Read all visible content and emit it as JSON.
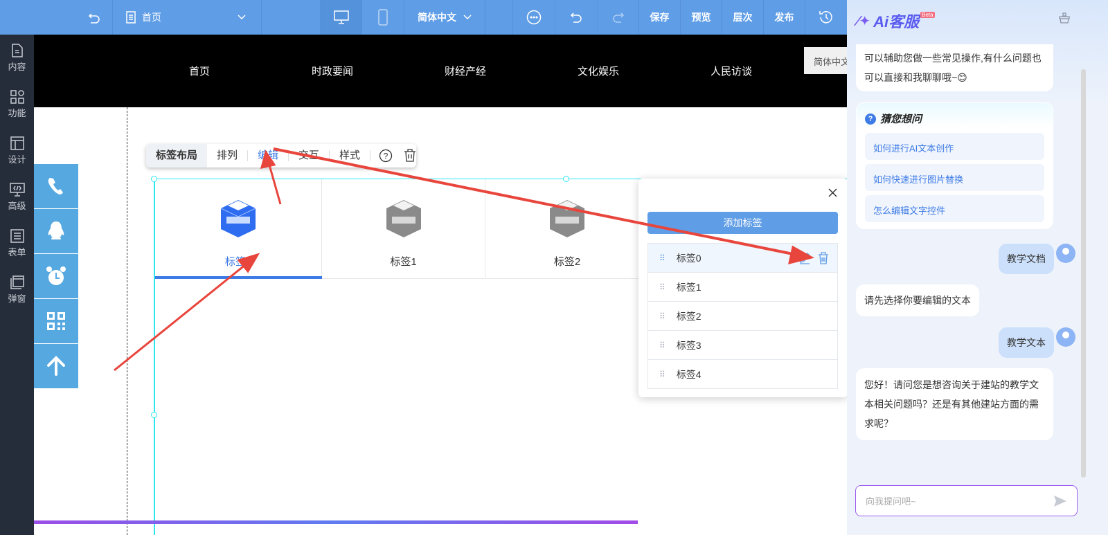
{
  "topbar": {
    "page_name": "首页",
    "language": "简体中文",
    "save": "保存",
    "preview": "预览",
    "layers": "层次",
    "publish": "发布"
  },
  "sidebar": [
    {
      "label": "内容",
      "icon": "file-icon"
    },
    {
      "label": "功能",
      "icon": "apps-icon"
    },
    {
      "label": "设计",
      "icon": "layout-icon"
    },
    {
      "label": "高级",
      "icon": "code-icon"
    },
    {
      "label": "表单",
      "icon": "form-icon"
    },
    {
      "label": "弹窗",
      "icon": "popup-icon"
    }
  ],
  "site_nav": {
    "items": [
      "首页",
      "时政要闻",
      "财经产经",
      "文化娱乐",
      "人民访谈"
    ],
    "language": "简体中文"
  },
  "float_buttons": [
    "phone-icon",
    "qq-icon",
    "alarm-icon",
    "qrcode-icon",
    "arrow-up-icon"
  ],
  "toolbar": {
    "title": "标签布局",
    "items": [
      "排列",
      "编辑",
      "交互",
      "样式"
    ]
  },
  "tabs": [
    {
      "label": "标签0",
      "active": true
    },
    {
      "label": "标签1"
    },
    {
      "label": "标签2"
    }
  ],
  "popup": {
    "add_label": "添加标签",
    "items": [
      "标签0",
      "标签1",
      "标签2",
      "标签3",
      "标签4"
    ]
  },
  "chat": {
    "title": "Ai客服",
    "badge": "Beta",
    "intro": "可以辅助您做一些常见操作,有什么问题也可以直接和我聊聊哦~😊",
    "suggest_title": "猜您想问",
    "suggestions": [
      "如何进行AI文本创作",
      "如何快速进行图片替换",
      "怎么编辑文字控件"
    ],
    "messages": [
      {
        "from": "user",
        "text": "教学文档"
      },
      {
        "from": "bot",
        "text": "请先选择你要编辑的文本"
      },
      {
        "from": "user",
        "text": "教学文本"
      },
      {
        "from": "bot",
        "text": "您好！请问您是想咨询关于建站的教学文本相关问题吗？还是有其他建站方面的需求呢？"
      }
    ],
    "input_placeholder": "向我提问吧~"
  },
  "colors": {
    "primary": "#5f9de6",
    "sidebar": "#252d3a",
    "accent": "#3d7be6",
    "arrow": "#e8453c"
  }
}
